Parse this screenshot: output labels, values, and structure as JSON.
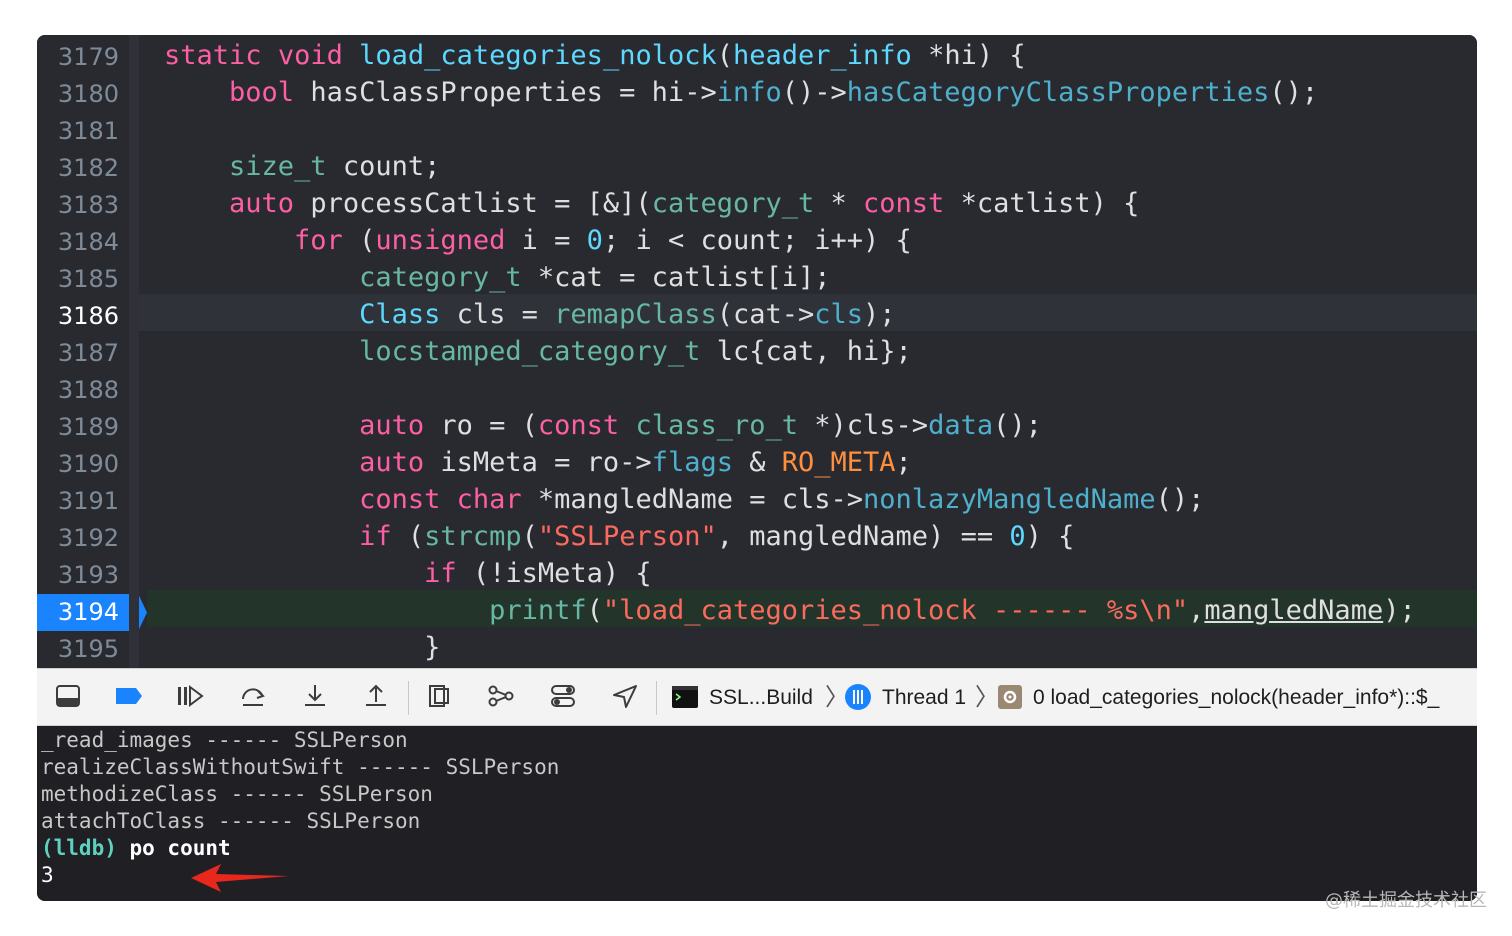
{
  "gutter": {
    "lines": [
      "3179",
      "3180",
      "3181",
      "3182",
      "3183",
      "3184",
      "3185",
      "3186",
      "3187",
      "3188",
      "3189",
      "3190",
      "3191",
      "3192",
      "3193",
      "3194",
      "3195"
    ]
  },
  "code": {
    "l3179": {
      "a": "static",
      "b": " ",
      "c": "void",
      "d": " ",
      "e": "load_categories_nolock",
      "f": "(",
      "g": "header_info",
      "h": " *hi) {"
    },
    "l3180": {
      "a": "    ",
      "b": "bool",
      "c": " hasClassProperties = hi->",
      "d": "info",
      "e": "()->",
      "f": "hasCategoryClassProperties",
      "g": "();"
    },
    "l3182": {
      "a": "    ",
      "b": "size_t",
      "c": " count;"
    },
    "l3183": {
      "a": "    ",
      "b": "auto",
      "c": " processCatlist = [&](",
      "d": "category_t",
      "e": " * ",
      "f": "const",
      "g": " *catlist) {"
    },
    "l3184": {
      "a": "        ",
      "b": "for",
      "c": " (",
      "d": "unsigned",
      "e": " i = ",
      "f": "0",
      "g": "; i < count; i++) {"
    },
    "l3185": {
      "a": "            ",
      "b": "category_t",
      "c": " *cat = catlist[i];"
    },
    "l3186": {
      "a": "            ",
      "b": "Class",
      "c": " cls = ",
      "d": "remapClass",
      "e": "(cat->",
      "f": "cls",
      "g": ");"
    },
    "l3187": {
      "a": "            ",
      "b": "locstamped_category_t",
      "c": " lc{cat, hi};"
    },
    "l3189": {
      "a": "            ",
      "b": "auto",
      "c": " ro = (",
      "d": "const",
      "e": " ",
      "f": "class_ro_t",
      "g": " *)cls->",
      "h": "data",
      "i": "();"
    },
    "l3190": {
      "a": "            ",
      "b": "auto",
      "c": " isMeta = ro->",
      "d": "flags",
      "e": " & ",
      "f": "RO_META",
      "g": ";"
    },
    "l3191": {
      "a": "            ",
      "b": "const",
      "c": " ",
      "d": "char",
      "e": " *mangledName = cls->",
      "f": "nonlazyMangledName",
      "g": "();"
    },
    "l3192": {
      "a": "            ",
      "b": "if",
      "c": " (",
      "d": "strcmp",
      "e": "(",
      "f": "\"SSLPerson\"",
      "g": ", mangledName) == ",
      "h": "0",
      "i": ") {"
    },
    "l3193": {
      "a": "                ",
      "b": "if",
      "c": " (!isMeta) {"
    },
    "l3194": {
      "a": "                    ",
      "b": "printf",
      "c": "(",
      "d": "\"load_categories_nolock ------ %s\\n\"",
      "e": ",",
      "f": "mangledName",
      "g": ");"
    },
    "l3195": {
      "a": "                ",
      "b": "}"
    }
  },
  "toolbar": {
    "icons": [
      "hide-debug-area-icon",
      "breakpoints-toggle-icon",
      "continue-icon",
      "step-over-icon",
      "step-into-icon",
      "step-out-icon",
      "view-hierarchy-icon",
      "memory-graph-icon",
      "environment-overrides-icon",
      "simulate-location-icon"
    ],
    "target": "SSL...Build",
    "thread": "Thread 1",
    "frame": "0 load_categories_nolock(header_info*)::$_"
  },
  "console": {
    "lines": [
      "_read_images ------ SSLPerson",
      "realizeClassWithoutSwift ------ SSLPerson",
      "methodizeClass ------ SSLPerson",
      "attachToClass ------ SSLPerson"
    ],
    "prompt": "(lldb)",
    "command": " po count",
    "output": "3"
  },
  "watermark": "@稀土掘金技术社区",
  "colors": {
    "editor_bg": "#292a30",
    "keyword": "#fc5fa3",
    "type": "#5dd8ff",
    "function": "#67b7a4",
    "string": "#fc6a5d",
    "number": "#d0bf69",
    "breakpoint": "#1a84ff",
    "arrow": "#e8271d"
  }
}
